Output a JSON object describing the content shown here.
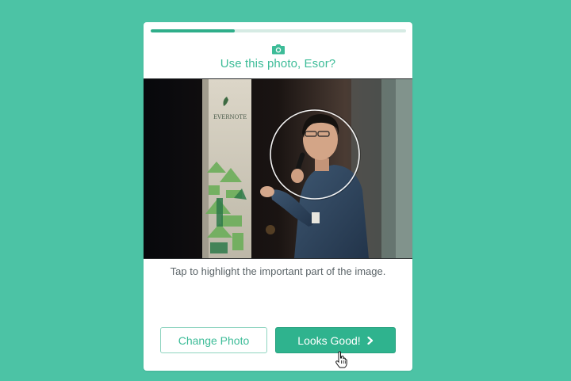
{
  "progress": {
    "value": 0.33
  },
  "header": {
    "icon": "camera-icon",
    "prompt": "Use this photo, Esor?"
  },
  "photo": {
    "alt_hint": "speaker-photo",
    "banner_text": "EVERNOTE"
  },
  "instructions": "Tap to highlight the important part of the image.",
  "buttons": {
    "change_label": "Change Photo",
    "confirm_label": "Looks Good!",
    "confirm_icon": "chevron-right-icon"
  },
  "colors": {
    "background": "#4cc3a5",
    "accent": "#2fb38e",
    "accent_text": "#3dbc98"
  }
}
